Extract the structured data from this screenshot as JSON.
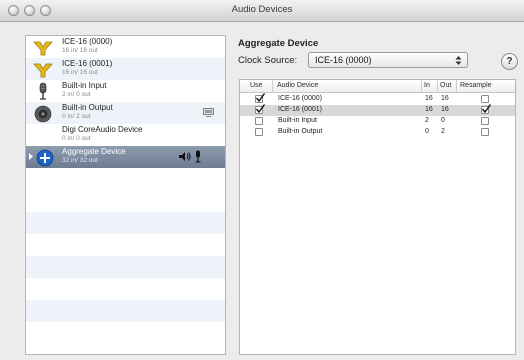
{
  "window": {
    "title": "Audio Devices"
  },
  "devices": [
    {
      "name": "ICE-16 (0000)",
      "io": "16 in/ 16 out",
      "icon": "ice-device-icon"
    },
    {
      "name": "ICE-16 (0001)",
      "io": "16 in/ 16 out",
      "icon": "ice-device-icon"
    },
    {
      "name": "Built-in Input",
      "io": "2 in/ 0 out",
      "icon": "microphone-icon"
    },
    {
      "name": "Built-in Output",
      "io": "0 in/ 2 out",
      "icon": "speaker-device-icon"
    },
    {
      "name": "Digi CoreAudio Device",
      "io": "0 in/ 0 out",
      "icon": ""
    },
    {
      "name": "Aggregate Device",
      "io": "32 in/ 32 out",
      "icon": "aggregate-plus-icon",
      "selected": true
    }
  ],
  "detail": {
    "title": "Aggregate Device",
    "clock_label": "Clock Source:",
    "clock_value": "ICE-16 (0000)",
    "help_label": "?"
  },
  "table": {
    "headers": {
      "use": "Use",
      "device": "Audio Device",
      "in": "In",
      "out": "Out",
      "resample": "Resample"
    },
    "rows": [
      {
        "device": "ICE-16 (0000)",
        "in": "16",
        "out": "16",
        "use": true,
        "resample": false
      },
      {
        "device": "ICE-16 (0001)",
        "in": "16",
        "out": "16",
        "use": true,
        "resample": true,
        "selected": true
      },
      {
        "device": "Built-in Input",
        "in": "2",
        "out": "0",
        "use": false,
        "resample": false
      },
      {
        "device": "Built-in Output",
        "in": "0",
        "out": "2",
        "use": false,
        "resample": false
      }
    ]
  },
  "colors": {
    "selection": "#7b899e",
    "stripe": "#eef2f9",
    "ice_icon": "#e6b91c",
    "aggregate_icon": "#1e63c8"
  }
}
